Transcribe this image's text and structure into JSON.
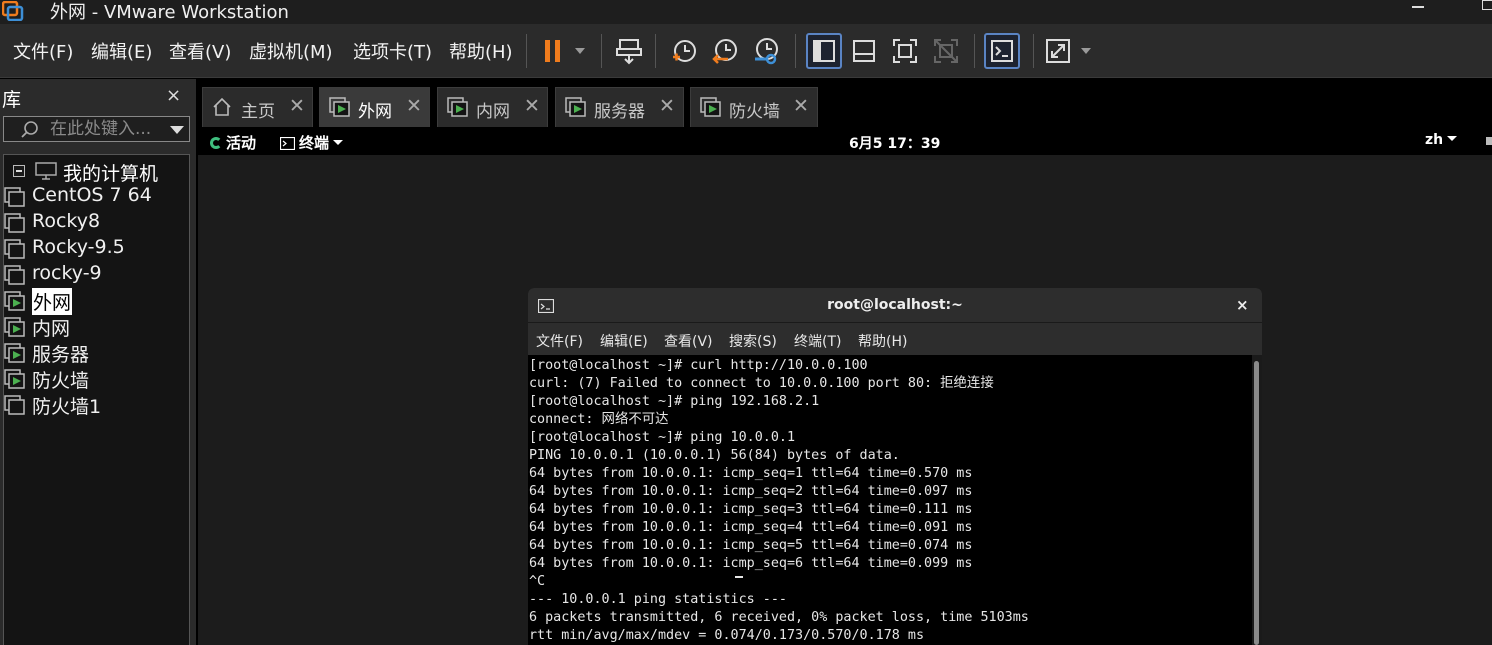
{
  "window": {
    "title": "外网 - VMware Workstation"
  },
  "menubar": {
    "items": [
      "文件(F)",
      "编辑(E)",
      "查看(V)",
      "虚拟机(M)",
      "选项卡(T)",
      "帮助(H)"
    ]
  },
  "toolbar": {
    "icons": [
      "pause-icon",
      "send-keys-icon",
      "snapshot-take-icon",
      "snapshot-revert-icon",
      "snapshot-manager-icon",
      "show-library-icon",
      "show-thumbnails-icon",
      "fullscreen-icon",
      "unity-icon",
      "console-view-icon",
      "stretch-icon"
    ],
    "accent_color": "#f07c1d",
    "active_outline_color": "#5a84c4"
  },
  "library": {
    "title": "库",
    "close": "×",
    "search_placeholder": "在此处键入...",
    "root_label": "我的计算机",
    "items": [
      {
        "label": "CentOS 7 64",
        "running": false,
        "selected": false
      },
      {
        "label": "Rocky8",
        "running": false,
        "selected": false
      },
      {
        "label": "Rocky-9.5",
        "running": false,
        "selected": false
      },
      {
        "label": "rocky-9",
        "running": false,
        "selected": false
      },
      {
        "label": "外网",
        "running": true,
        "selected": true
      },
      {
        "label": "内网",
        "running": true,
        "selected": false
      },
      {
        "label": "服务器",
        "running": true,
        "selected": false
      },
      {
        "label": "防火墙",
        "running": true,
        "selected": false
      },
      {
        "label": "防火墙1",
        "running": false,
        "selected": false
      }
    ]
  },
  "tabs": [
    {
      "label": "主页",
      "icon": "home-icon",
      "active": false
    },
    {
      "label": "外网",
      "icon": "vm-running-icon",
      "active": true
    },
    {
      "label": "内网",
      "icon": "vm-running-icon",
      "active": false
    },
    {
      "label": "服务器",
      "icon": "vm-running-icon",
      "active": false
    },
    {
      "label": "防火墙",
      "icon": "vm-running-icon",
      "active": false
    }
  ],
  "gnome": {
    "activities": "活动",
    "app_menu": "终端",
    "clock": "6月5 17：39",
    "lang": "zh"
  },
  "terminal": {
    "title": "root@localhost:~",
    "close": "×",
    "menu": [
      "文件(F)",
      "编辑(E)",
      "查看(V)",
      "搜索(S)",
      "终端(T)",
      "帮助(H)"
    ],
    "lines": [
      "[root@localhost ~]# curl http://10.0.0.100",
      "curl: (7) Failed to connect to 10.0.0.100 port 80: 拒绝连接",
      "[root@localhost ~]# ping 192.168.2.1",
      "connect: 网络不可达",
      "[root@localhost ~]# ping 10.0.0.1",
      "PING 10.0.0.1 (10.0.0.1) 56(84) bytes of data.",
      "64 bytes from 10.0.0.1: icmp_seq=1 ttl=64 time=0.570 ms",
      "64 bytes from 10.0.0.1: icmp_seq=2 ttl=64 time=0.097 ms",
      "64 bytes from 10.0.0.1: icmp_seq=3 ttl=64 time=0.111 ms",
      "64 bytes from 10.0.0.1: icmp_seq=4 ttl=64 time=0.091 ms",
      "64 bytes from 10.0.0.1: icmp_seq=5 ttl=64 time=0.074 ms",
      "64 bytes from 10.0.0.1: icmp_seq=6 ttl=64 time=0.099 ms",
      "^C",
      "--- 10.0.0.1 ping statistics ---",
      "6 packets transmitted, 6 received, 0% packet loss, time 5103ms",
      "rtt min/avg/max/mdev = 0.074/0.173/0.570/0.178 ms"
    ]
  }
}
